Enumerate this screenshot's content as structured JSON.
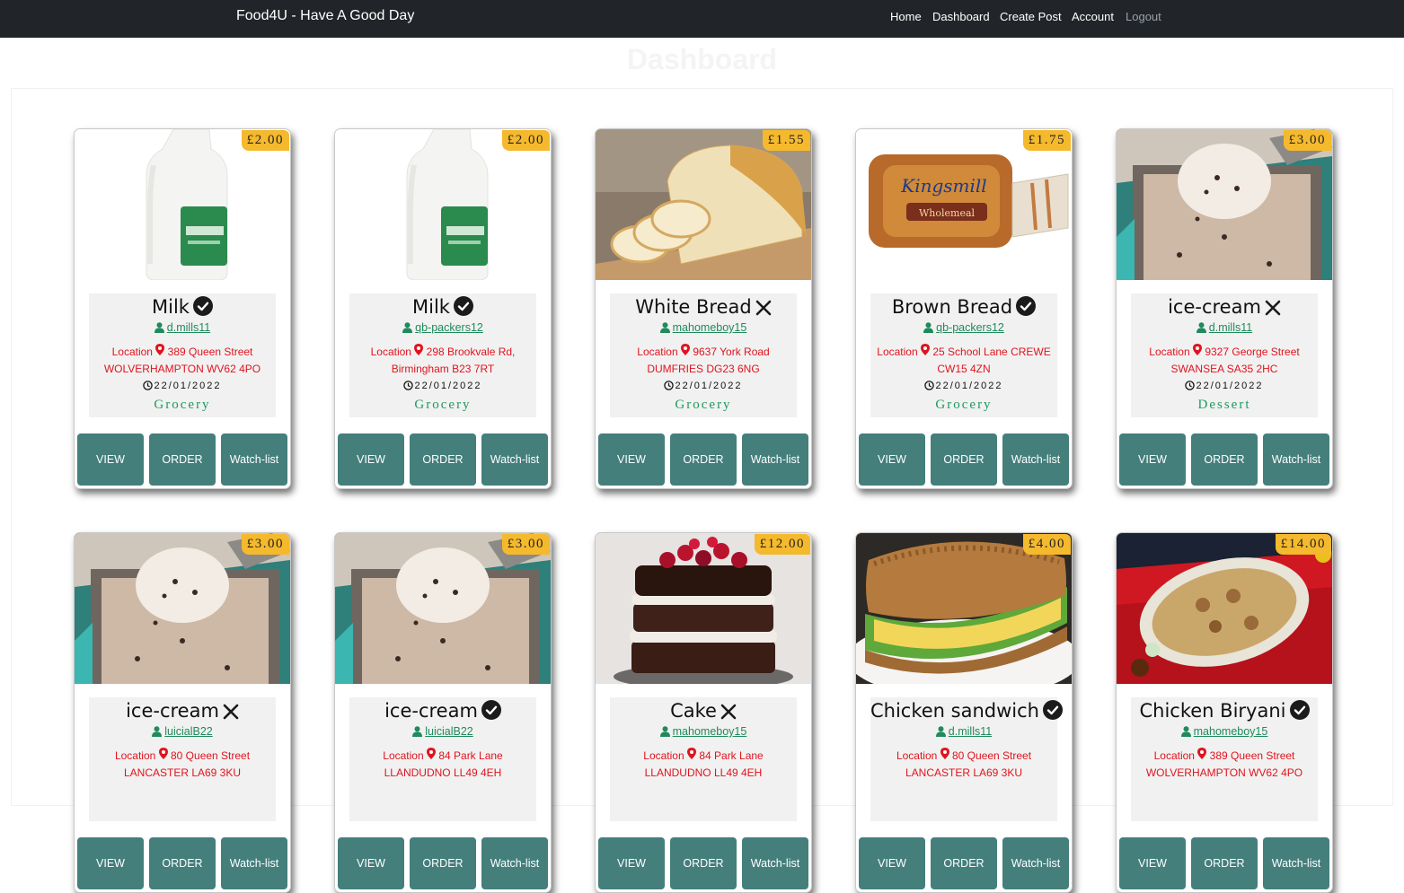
{
  "header": {
    "brand": "Food4U - Have A Good Day",
    "nav": [
      "Home",
      "Dashboard",
      "Create Post",
      "Account",
      "Logout"
    ]
  },
  "page": {
    "title": "Dashboard"
  },
  "colors": {
    "navbar": "#212529",
    "price_badge": "#f5b92d",
    "button": "#447f7c",
    "location": "#e0141e",
    "username": "#1f8a5c"
  },
  "buttons": {
    "view": "VIEW",
    "order": "ORDER",
    "watch": "Watch-list"
  },
  "location_label": "Location",
  "cards": [
    {
      "price": "£2.00",
      "title": "Milk",
      "status": "available",
      "user": "d.mills11",
      "address": "389 Queen Street WOLVERHAMPTON WV62 4PO",
      "date": "22/01/2022",
      "category": "Grocery",
      "image": "milk"
    },
    {
      "price": "£2.00",
      "title": "Milk",
      "status": "available",
      "user": "qb-packers12",
      "address": "298 Brookvale Rd, Birmingham B23 7RT",
      "date": "22/01/2022",
      "category": "Grocery",
      "image": "milk"
    },
    {
      "price": "£1.55",
      "title": "White Bread",
      "status": "unavailable",
      "user": "mahomeboy15",
      "address": "9637 York Road DUMFRIES DG23 6NG",
      "date": "22/01/2022",
      "category": "Grocery",
      "image": "white-bread"
    },
    {
      "price": "£1.75",
      "title": "Brown Bread",
      "status": "available",
      "user": "qb-packers12",
      "address": "25 School Lane CREWE CW15 4ZN",
      "date": "22/01/2022",
      "category": "Grocery",
      "image": "brown-bread"
    },
    {
      "price": "£3.00",
      "title": "ice-cream",
      "status": "unavailable",
      "user": "d.mills11",
      "address": "9327 George Street SWANSEA SA35 2HC",
      "date": "22/01/2022",
      "category": "Dessert",
      "image": "ice-cream"
    },
    {
      "price": "£3.00",
      "title": "ice-cream",
      "status": "unavailable",
      "user": "luicialB22",
      "address": "80 Queen Street LANCASTER LA69 3KU",
      "date": "",
      "category": "",
      "image": "ice-cream"
    },
    {
      "price": "£3.00",
      "title": "ice-cream",
      "status": "available",
      "user": "luicialB22",
      "address": "84 Park Lane LLANDUDNO LL49 4EH",
      "date": "",
      "category": "",
      "image": "ice-cream"
    },
    {
      "price": "£12.00",
      "title": "Cake",
      "status": "unavailable",
      "user": "mahomeboy15",
      "address": "84 Park Lane LLANDUDNO LL49 4EH",
      "date": "",
      "category": "",
      "image": "cake"
    },
    {
      "price": "£4.00",
      "title": "Chicken sandwich",
      "status": "available",
      "user": "d.mills11",
      "address": "80 Queen Street LANCASTER LA69 3KU",
      "date": "",
      "category": "",
      "image": "sandwich"
    },
    {
      "price": "£14.00",
      "title": "Chicken Biryani",
      "status": "available",
      "user": "mahomeboy15",
      "address": "389 Queen Street WOLVERHAMPTON WV62 4PO",
      "date": "",
      "category": "",
      "image": "biryani"
    }
  ]
}
